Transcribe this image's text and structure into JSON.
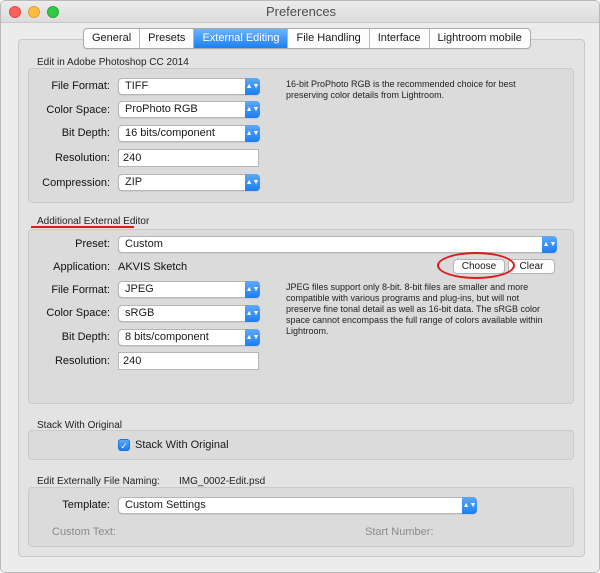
{
  "window": {
    "title": "Preferences"
  },
  "tabs": [
    {
      "label": "General",
      "active": false
    },
    {
      "label": "Presets",
      "active": false
    },
    {
      "label": "External Editing",
      "active": true
    },
    {
      "label": "File Handling",
      "active": false
    },
    {
      "label": "Interface",
      "active": false
    },
    {
      "label": "Lightroom mobile",
      "active": false
    }
  ],
  "photoshop_section": {
    "title": "Edit in Adobe Photoshop CC 2014",
    "file_format_label": "File Format:",
    "file_format_value": "TIFF",
    "color_space_label": "Color Space:",
    "color_space_value": "ProPhoto RGB",
    "bit_depth_label": "Bit Depth:",
    "bit_depth_value": "16 bits/component",
    "resolution_label": "Resolution:",
    "resolution_value": "240",
    "compression_label": "Compression:",
    "compression_value": "ZIP",
    "note": "16-bit ProPhoto RGB is the recommended choice for best preserving color details from Lightroom."
  },
  "additional_editor": {
    "title": "Additional External Editor",
    "preset_label": "Preset:",
    "preset_value": "Custom",
    "application_label": "Application:",
    "application_value": "AKVIS Sketch",
    "choose_label": "Choose",
    "clear_label": "Clear",
    "file_format_label": "File Format:",
    "file_format_value": "JPEG",
    "color_space_label": "Color Space:",
    "color_space_value": "sRGB",
    "bit_depth_label": "Bit Depth:",
    "bit_depth_value": "8 bits/component",
    "resolution_label": "Resolution:",
    "resolution_value": "240",
    "note": "JPEG files support only 8-bit. 8-bit files are smaller and more compatible with various programs and plug-ins, but will not preserve fine tonal detail as well as 16-bit data. The sRGB color space cannot encompass the full range of colors available within Lightroom."
  },
  "stack_section": {
    "title": "Stack With Original",
    "checkbox_label": "Stack With Original",
    "checked": true
  },
  "naming_section": {
    "title": "Edit Externally File Naming:",
    "example": "IMG_0002-Edit.psd",
    "template_label": "Template:",
    "template_value": "Custom Settings",
    "custom_text_label": "Custom Text:",
    "start_number_label": "Start Number:"
  },
  "colors": {
    "accent": "#1b7ef2",
    "annotation_red": "#d91b1b",
    "close": "#fc605c",
    "minimize": "#fdbc40",
    "maximize": "#34c84a"
  },
  "icons": {
    "popup_arrows": "updown-chevron-icon",
    "checkmark": "checkmark-icon"
  }
}
